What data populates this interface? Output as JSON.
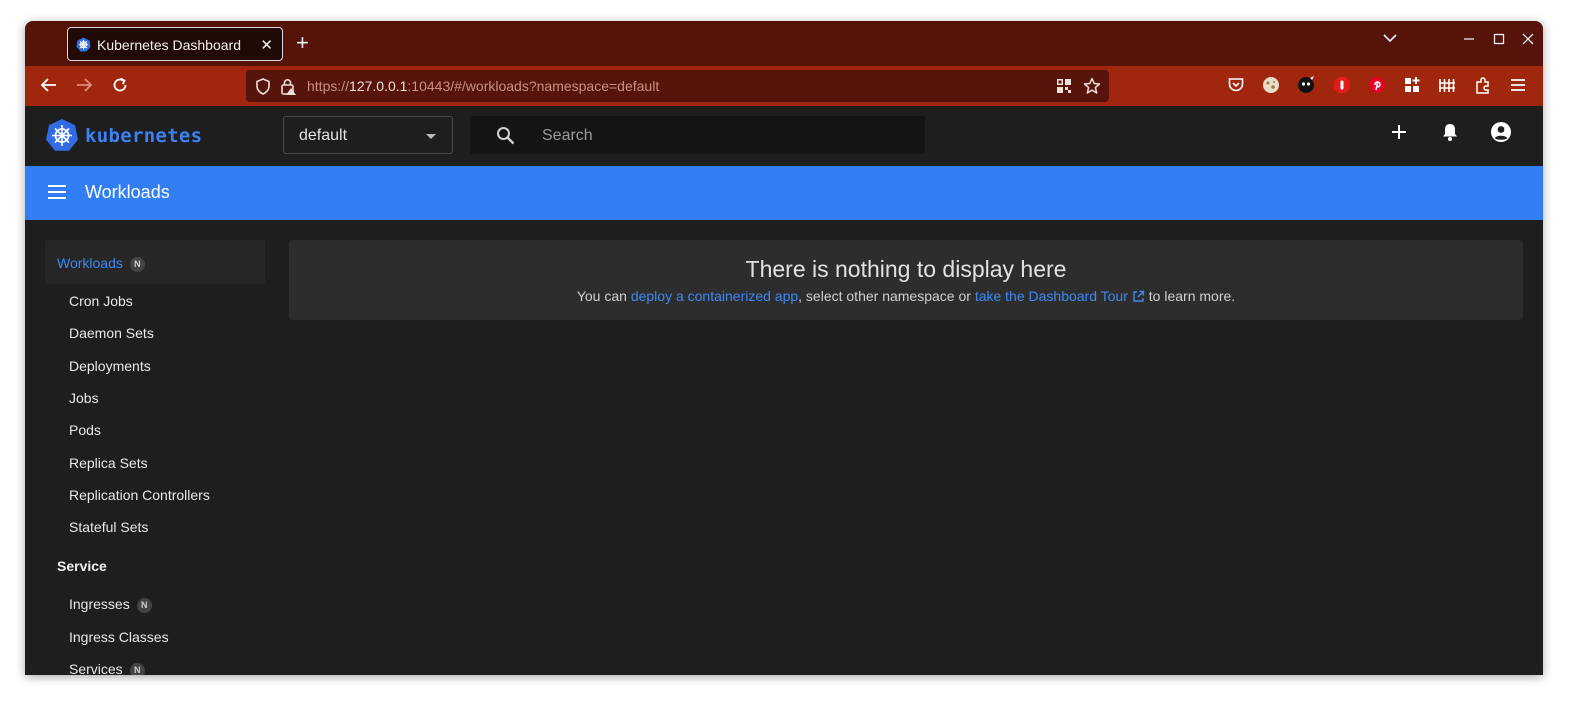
{
  "browser": {
    "tab_title": "Kubernetes Dashboard",
    "tab_close": "✕",
    "new_tab": "+",
    "url_prefix": "https://",
    "url_host": "127.0.0.1",
    "url_rest": ":10443/#/workloads?namespace=default"
  },
  "app": {
    "brand": "kubernetes",
    "namespace": "default",
    "search_placeholder": "Search",
    "page_title": "Workloads"
  },
  "sidebar": {
    "workloads_label": "Workloads",
    "workloads_badge": "N",
    "workload_items": [
      "Cron Jobs",
      "Daemon Sets",
      "Deployments",
      "Jobs",
      "Pods",
      "Replica Sets",
      "Replication Controllers",
      "Stateful Sets"
    ],
    "service_label": "Service",
    "service_items": [
      {
        "label": "Ingresses",
        "badge": "N"
      },
      {
        "label": "Ingress Classes",
        "badge": ""
      },
      {
        "label": "Services",
        "badge": "N"
      }
    ]
  },
  "empty_state": {
    "heading": "There is nothing to display here",
    "text_1": "You can ",
    "link_1": "deploy a containerized app",
    "text_2": ", select other namespace or ",
    "link_2": "take the Dashboard Tour",
    "text_3": " to learn more."
  },
  "colors": {
    "tab_strip": "#56130a",
    "nav_bar": "#a0270d",
    "accent": "#327ff5",
    "link": "#3c89f6"
  }
}
